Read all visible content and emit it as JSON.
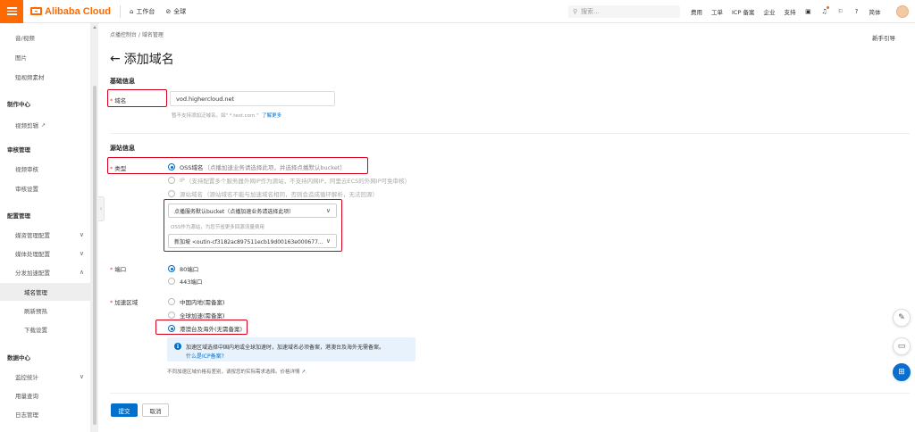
{
  "topbar": {
    "brand": "Alibaba Cloud",
    "workbench": "工作台",
    "region": "全球",
    "search_placeholder": "搜索...",
    "links": [
      "费用",
      "工单",
      "ICP 备案",
      "企业",
      "支持"
    ],
    "language": "简体"
  },
  "sidebar": {
    "items": [
      {
        "label": "音/视频",
        "type": "sub"
      },
      {
        "label": "图片",
        "type": "sub"
      },
      {
        "label": "短视频素材",
        "type": "sub"
      },
      {
        "label": "制作中心",
        "type": "group"
      },
      {
        "label": "视频剪辑",
        "type": "sub"
      },
      {
        "label": "审核管理",
        "type": "group"
      },
      {
        "label": "视频审核",
        "type": "sub"
      },
      {
        "label": "审核设置",
        "type": "sub"
      },
      {
        "label": "配置管理",
        "type": "group"
      },
      {
        "label": "媒资管理配置",
        "type": "sub"
      },
      {
        "label": "媒体处理配置",
        "type": "sub"
      },
      {
        "label": "分发加速配置",
        "type": "sub"
      },
      {
        "label": "域名管理",
        "type": "sub2"
      },
      {
        "label": "刷新预热",
        "type": "sub2"
      },
      {
        "label": "下载设置",
        "type": "sub2"
      },
      {
        "label": "数据中心",
        "type": "group"
      },
      {
        "label": "监控统计",
        "type": "sub"
      },
      {
        "label": "用量查询",
        "type": "sub"
      },
      {
        "label": "日志管理",
        "type": "sub"
      }
    ]
  },
  "main": {
    "breadcrumb": "点播控制台  /  域名管理",
    "guide": "新手引导",
    "title": "添加域名",
    "basic_section": "基础信息",
    "domain_label": "域名",
    "domain_value": "vod.highercloud.net",
    "domain_help": "暂不支持添加泛域名，如\" *.test.com \"",
    "domain_help_link": "了解更多",
    "origin_section": "源站信息",
    "type_label": "类型",
    "type_options": [
      {
        "main": "OSS域名",
        "desc": "（点播加速业务请选择此项，并选择点播默认bucket）"
      },
      {
        "main": "IP",
        "desc": "（支持配置多个服务器外网IP作为源站，不支持内网IP，阿里云ECS的外网IP可免审核）"
      },
      {
        "main": "源站域名",
        "desc": "（源站域名不能与加速域名相同，否则会造成循环解析，无法回源）"
      }
    ],
    "bucket_select": "点播服务默认bucket（点播加速业务请选择此项）",
    "bucket_help": "OSS作为源站，为您节省更多回源流量费用",
    "bucket_region": "新加坡 <outin-cf3182ac897511ecb19d00163e000677...",
    "port_label": "端口",
    "port_options": [
      "80端口",
      "443端口"
    ],
    "region_label": "加速区域",
    "region_options": [
      "中国内地(需备案)",
      "全球加速(需备案)",
      "港澳台及海外(无需备案)"
    ],
    "info_text": "加速区域选择中国内地或全球加速时，加速域名必须备案，港澳台及海外无需备案。",
    "info_link": "什么是ICP备案?",
    "price_note": "不同加速区域价格有差别，请按您的实际需求选择。价格详情",
    "submit": "提交",
    "cancel": "取消"
  },
  "colors": {
    "brand": "#ff6a00",
    "primary": "#0070cc",
    "highlight": "#d9001b"
  }
}
